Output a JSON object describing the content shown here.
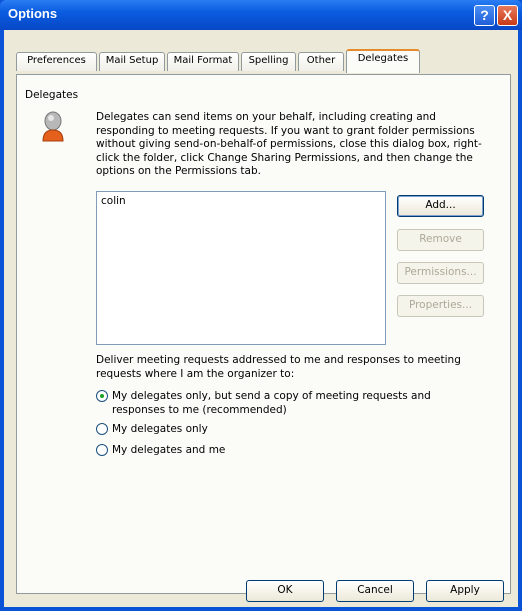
{
  "window": {
    "title": "Options",
    "help_label": "?",
    "close_label": "X"
  },
  "tabs": [
    "Preferences",
    "Mail Setup",
    "Mail Format",
    "Spelling",
    "Other",
    "Delegates"
  ],
  "active_tab": "Delegates",
  "delegates": {
    "group_label": "Delegates",
    "description": "Delegates can send items on your behalf, including creating and responding to meeting requests. If you want to grant folder permissions without giving send-on-behalf-of permissions, close this dialog box, right-click the folder, click Change Sharing Permissions, and then change the options on the Permissions tab.",
    "list_items": [
      "colin"
    ],
    "add_label": "Add...",
    "remove_label": "Remove",
    "permissions_label": "Permissions...",
    "properties_label": "Properties...",
    "deliver_text": "Deliver meeting requests addressed to me and responses to meeting requests where I am the organizer to:",
    "options": [
      {
        "label": "My delegates only, but send a copy of meeting requests and responses to me (recommended)",
        "checked": true
      },
      {
        "label": "My delegates only",
        "checked": false
      },
      {
        "label": "My delegates and me",
        "checked": false
      }
    ]
  },
  "footer": {
    "ok_label": "OK",
    "cancel_label": "Cancel",
    "apply_label": "Apply"
  },
  "colors": {
    "titlebar": "#0a5ce0",
    "dialog_bg": "#ece9d8",
    "active_tab_accent": "#e68b2c"
  }
}
